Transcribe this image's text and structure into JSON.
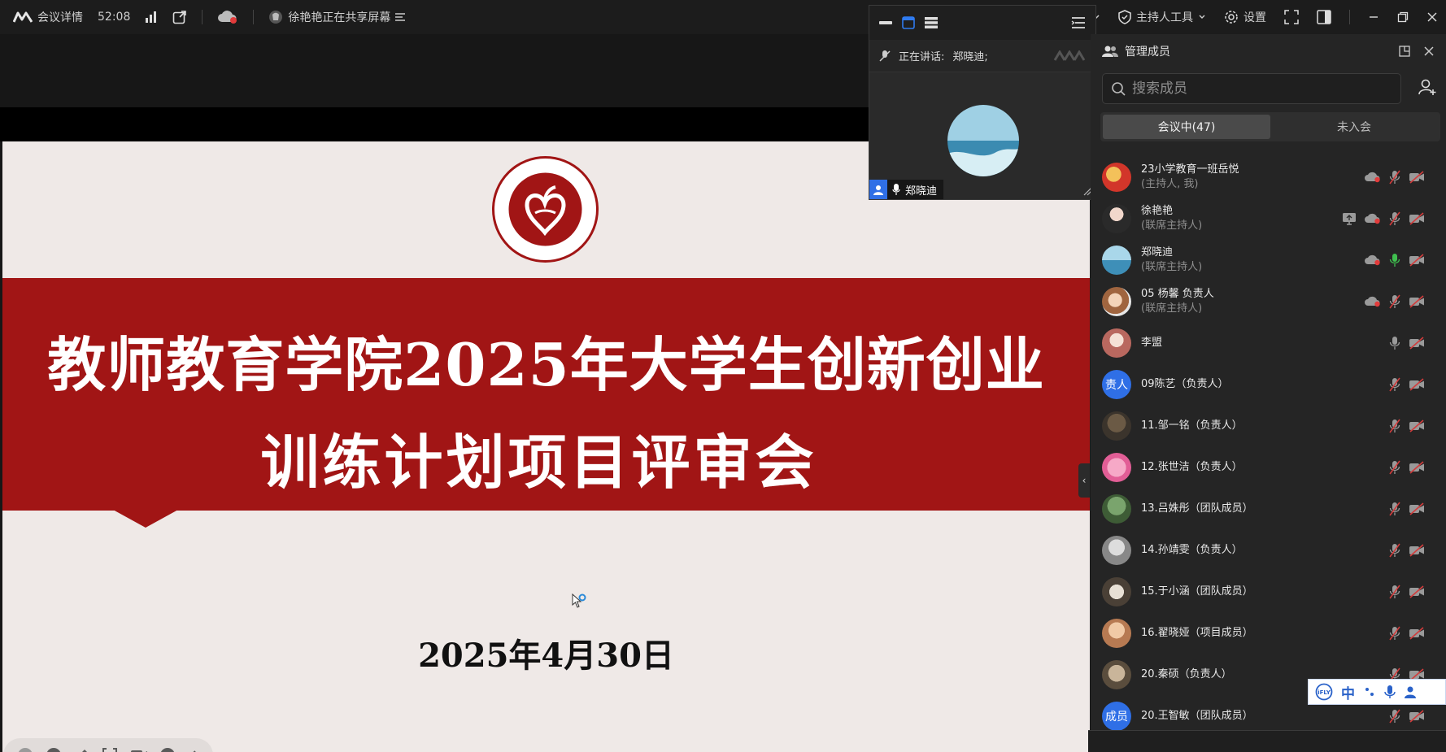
{
  "topbar": {
    "meeting_details": "会议详情",
    "timer": "52:08",
    "sharing_text": "徐艳艳正在共享屏幕",
    "host_tools": "主持人工具",
    "settings": "设置"
  },
  "video_panel": {
    "speaking_label": "正在讲话:",
    "speaking_name": "郑晓迪;",
    "tile_name": "郑晓迪"
  },
  "slide": {
    "title_line1": "教师教育学院2025年大学生创新创业",
    "title_line2": "训练计划项目评审会",
    "date": "2025年4月30日"
  },
  "panel": {
    "title": "管理成员",
    "search_placeholder": "搜索成员",
    "tab_in_meeting": "会议中(47)",
    "tab_not_joined": "未入会",
    "members": [
      {
        "name": "23小学教育一班岳悦",
        "role": "(主持人, 我)"
      },
      {
        "name": "徐艳艳",
        "role": "(联席主持人)"
      },
      {
        "name": "郑晓迪",
        "role": "(联席主持人)"
      },
      {
        "name": "05 杨馨 负责人",
        "role": "(联席主持人)"
      },
      {
        "name": "李盟",
        "role": ""
      },
      {
        "name": "09陈艺（负责人）",
        "role": "",
        "avatar_text": "责人"
      },
      {
        "name": "11.邹一铭（负责人）",
        "role": ""
      },
      {
        "name": "12.张世洁（负责人）",
        "role": ""
      },
      {
        "name": "13.吕姝彤（团队成员）",
        "role": ""
      },
      {
        "name": "14.孙靖雯（负责人）",
        "role": ""
      },
      {
        "name": "15.于小涵（团队成员）",
        "role": ""
      },
      {
        "name": "16.翟晓娅（项目成员）",
        "role": ""
      },
      {
        "name": "20.秦硕（负责人）",
        "role": ""
      },
      {
        "name": "20.王智敏（团队成员）",
        "role": "",
        "avatar_text": "成员"
      }
    ]
  },
  "ime": {
    "mode": "中"
  },
  "colors": {
    "slide_red": "#a11515",
    "panel_bg": "#252525",
    "mic_green": "#3fbf4f",
    "mic_muted": "#d23c3c"
  }
}
